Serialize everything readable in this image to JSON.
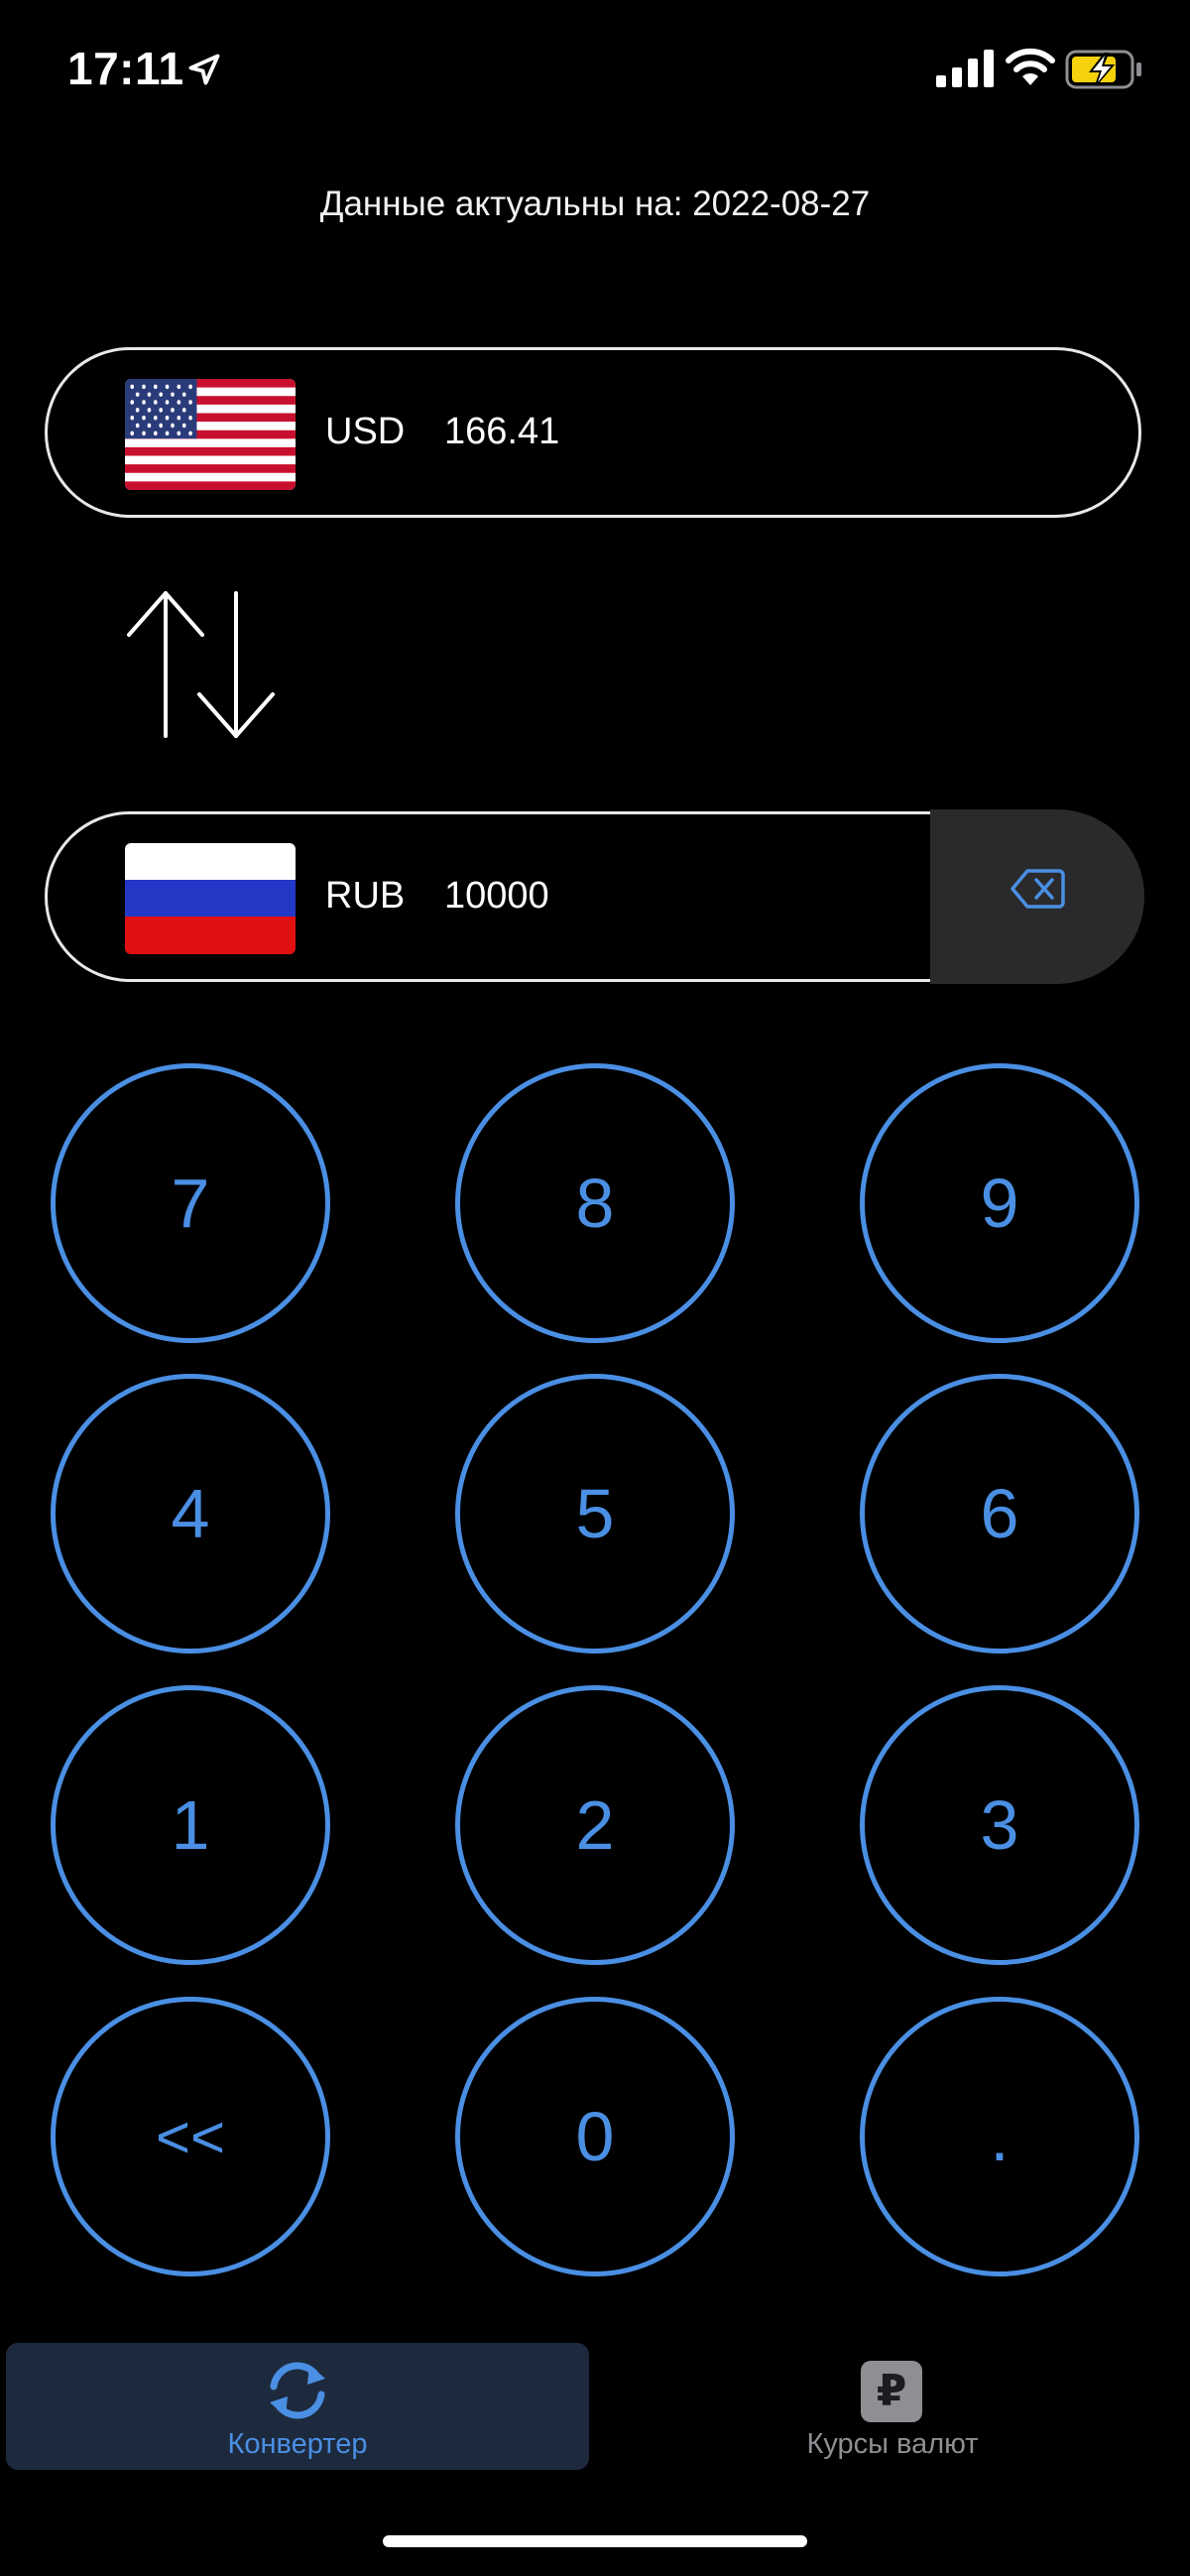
{
  "status_bar": {
    "time": "17:11",
    "icons": [
      "location-arrow-icon",
      "cellular-signal-icon",
      "wifi-icon",
      "battery-charging-icon"
    ]
  },
  "header": {
    "updated_text": "Данные актуальны на: 2022-08-27"
  },
  "converter": {
    "from": {
      "code": "USD",
      "amount": "166.41",
      "flag": "us-flag-icon"
    },
    "to": {
      "code": "RUB",
      "amount": "10000",
      "flag": "ru-flag-icon"
    },
    "swap_icon": "swap-arrows-icon",
    "backspace_icon": "delete-backward-icon"
  },
  "keypad": {
    "keys": [
      "7",
      "8",
      "9",
      "4",
      "5",
      "6",
      "1",
      "2",
      "3",
      "<<",
      "0",
      "."
    ]
  },
  "tab_bar": {
    "tabs": [
      {
        "label": "Конвертер",
        "icon": "refresh-cycle-icon",
        "active": true
      },
      {
        "label": "Курсы валют",
        "icon": "ruble-sign-icon",
        "active": false,
        "icon_glyph": "₽"
      }
    ]
  },
  "colors": {
    "background": "#000000",
    "accent_blue": "#4a8fe3",
    "inactive_gray": "#8e8e93",
    "battery_yellow": "#f5d20c"
  }
}
